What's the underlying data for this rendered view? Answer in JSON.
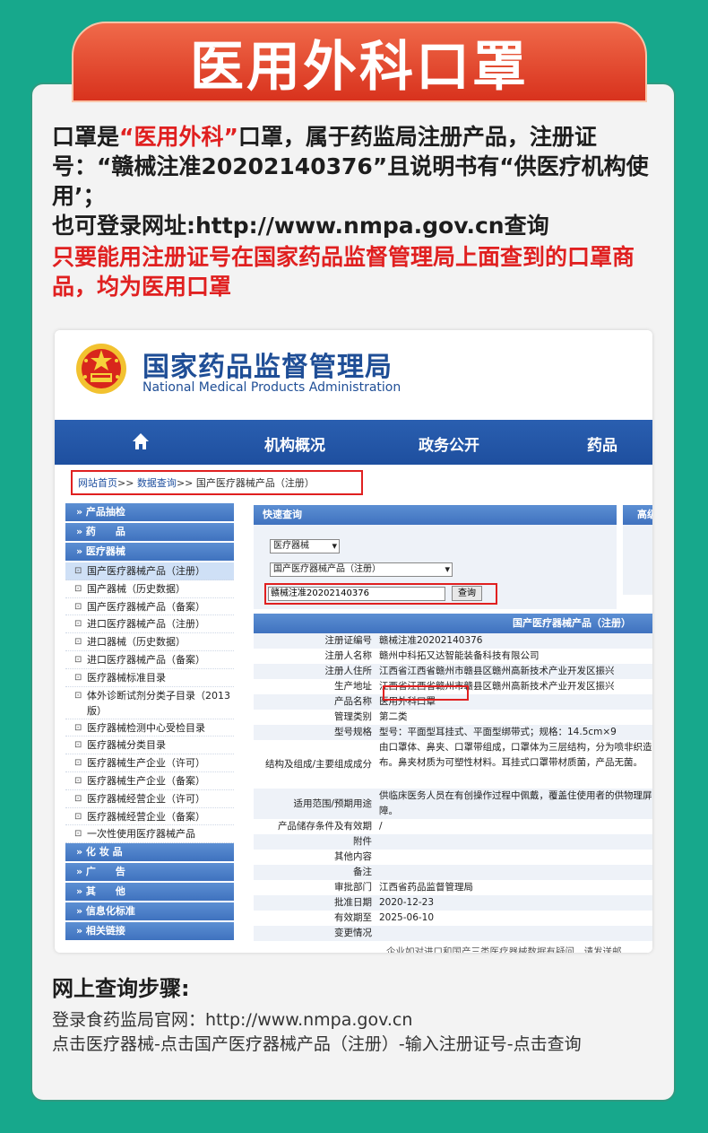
{
  "banner": {
    "title": "医用外科口罩"
  },
  "intro": {
    "p1_a": "口罩是",
    "p1_red": "“医用外科”",
    "p1_b": "口罩，属于药监局注册产品，注册证号：“赣械注准20202140376”且说明书有“供医疗机构使用’；",
    "p2": "也可登录网址:http://www.nmpa.gov.cn查询",
    "p3": "只要能用注册证号在国家药品监督管理局上面查到的口罩商品，均为医用口罩"
  },
  "site": {
    "name_cn": "国家药品监督管理局",
    "name_en": "National Medical Products Administration",
    "nav": [
      "机构概况",
      "政务公开",
      "药品"
    ],
    "breadcrumb": {
      "home": "网站首页",
      "sep": ">>",
      "query": "数据查询",
      "current": "国产医疗器械产品（注册）"
    }
  },
  "sidebar": {
    "sections_top": [
      "» 产品抽检",
      "» 药　　品",
      "» 医疗器械"
    ],
    "items": [
      "国产医疗器械产品（注册）",
      "国产器械（历史数据）",
      "国产医疗器械产品（备案）",
      "进口医疗器械产品（注册）",
      "进口器械（历史数据）",
      "进口医疗器械产品（备案）",
      "医疗器械标准目录",
      "体外诊断试剂分类子目录（2013版）",
      "医疗器械检测中心受检目录",
      "医疗器械分类目录",
      "医疗器械生产企业（许可）",
      "医疗器械生产企业（备案）",
      "医疗器械经营企业（许可）",
      "医疗器械经营企业（备案）",
      "一次性使用医疗器械产品"
    ],
    "sections_bottom": [
      "» 化 妆 品",
      "» 广　　告",
      "» 其　　他",
      "» 信息化标准",
      "» 相关链接"
    ]
  },
  "quick_search": {
    "title": "快速查询",
    "select1": "医疗器械",
    "select2": "国产医疗器械产品（注册）",
    "input_value": "赣械注准20202140376",
    "button": "查询",
    "side_title": "高级"
  },
  "result": {
    "title": "国产医疗器械产品（注册）",
    "rows": [
      {
        "label": "注册证编号",
        "value": "赣械注准20202140376"
      },
      {
        "label": "注册人名称",
        "value": "赣州中科拓又达智能装备科技有限公司"
      },
      {
        "label": "注册人住所",
        "value": "江西省江西省赣州市赣县区赣州高新技术产业开发区振兴"
      },
      {
        "label": "生产地址",
        "value": "江西省江西省赣州市赣县区赣州高新技术产业开发区振兴"
      },
      {
        "label": "产品名称",
        "value": "医用外科口罩"
      },
      {
        "label": "管理类别",
        "value": "第二类"
      },
      {
        "label": "型号规格",
        "value": "型号：平面型耳挂式、平面型绑带式；规格：14.5cm×9"
      },
      {
        "label": "结构及组成/主要组成成分",
        "value": "由口罩体、鼻夹、口罩带组成，口罩体为三层结构，分为喷非织造布。鼻夹材质为可塑性材料。耳挂式口罩带材质菌，产品无菌。"
      },
      {
        "label": "适用范围/预期用途",
        "value": "供临床医务人员在有创操作过程中佩戴，覆盖住使用者的供物理屏障。"
      },
      {
        "label": "产品储存条件及有效期",
        "value": "/"
      },
      {
        "label": "附件",
        "value": ""
      },
      {
        "label": "其他内容",
        "value": ""
      },
      {
        "label": "备注",
        "value": ""
      },
      {
        "label": "审批部门",
        "value": "江西省药品监督管理局"
      },
      {
        "label": "批准日期",
        "value": "2020-12-23"
      },
      {
        "label": "有效期至",
        "value": "2025-06-10"
      },
      {
        "label": "变更情况",
        "value": ""
      }
    ],
    "footer_note": "企业如对进口和国产三类医疗器械数据有疑问，请发送邮"
  },
  "steps": {
    "title": "网上查询步骤:",
    "line1": "登录食药监局官网：http://www.nmpa.gov.cn",
    "line2": "点击医疗器械-点击国产医疗器械产品（注册）-输入注册证号-点击查询"
  },
  "colors": {
    "accent_green": "#17a88c",
    "banner_red": "#e0412a",
    "nav_blue": "#1e4f9f",
    "highlight_red": "#e02020"
  }
}
